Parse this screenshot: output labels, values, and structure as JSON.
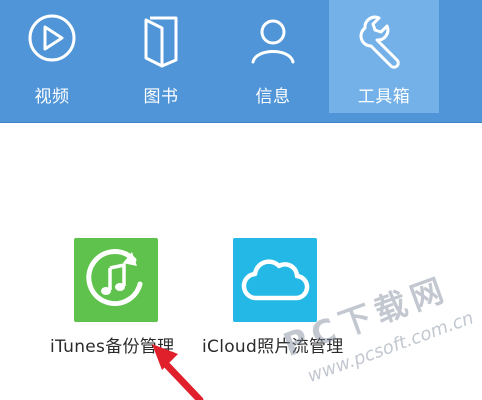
{
  "toolbar": {
    "tabs": [
      {
        "label": "视频",
        "icon": "play-circle-icon"
      },
      {
        "label": "图书",
        "icon": "book-icon"
      },
      {
        "label": "信息",
        "icon": "person-icon"
      },
      {
        "label": "工具箱",
        "icon": "wrench-icon",
        "selected": true
      }
    ],
    "background": "#4f95d8",
    "selected_background": "#74b1e8"
  },
  "tools": {
    "itunes_backup": {
      "label": "iTunes备份管理",
      "icon": "music-restore-icon",
      "color": "#5fc24d"
    },
    "icloud_photos": {
      "label": "iCloud照片流管理",
      "icon": "cloud-icon",
      "color": "#23b8e6"
    }
  },
  "watermark": {
    "main": "PC下载网",
    "url": "www.pcsoft.com.cn"
  },
  "annotation": {
    "arrow_color": "#e0202a"
  }
}
